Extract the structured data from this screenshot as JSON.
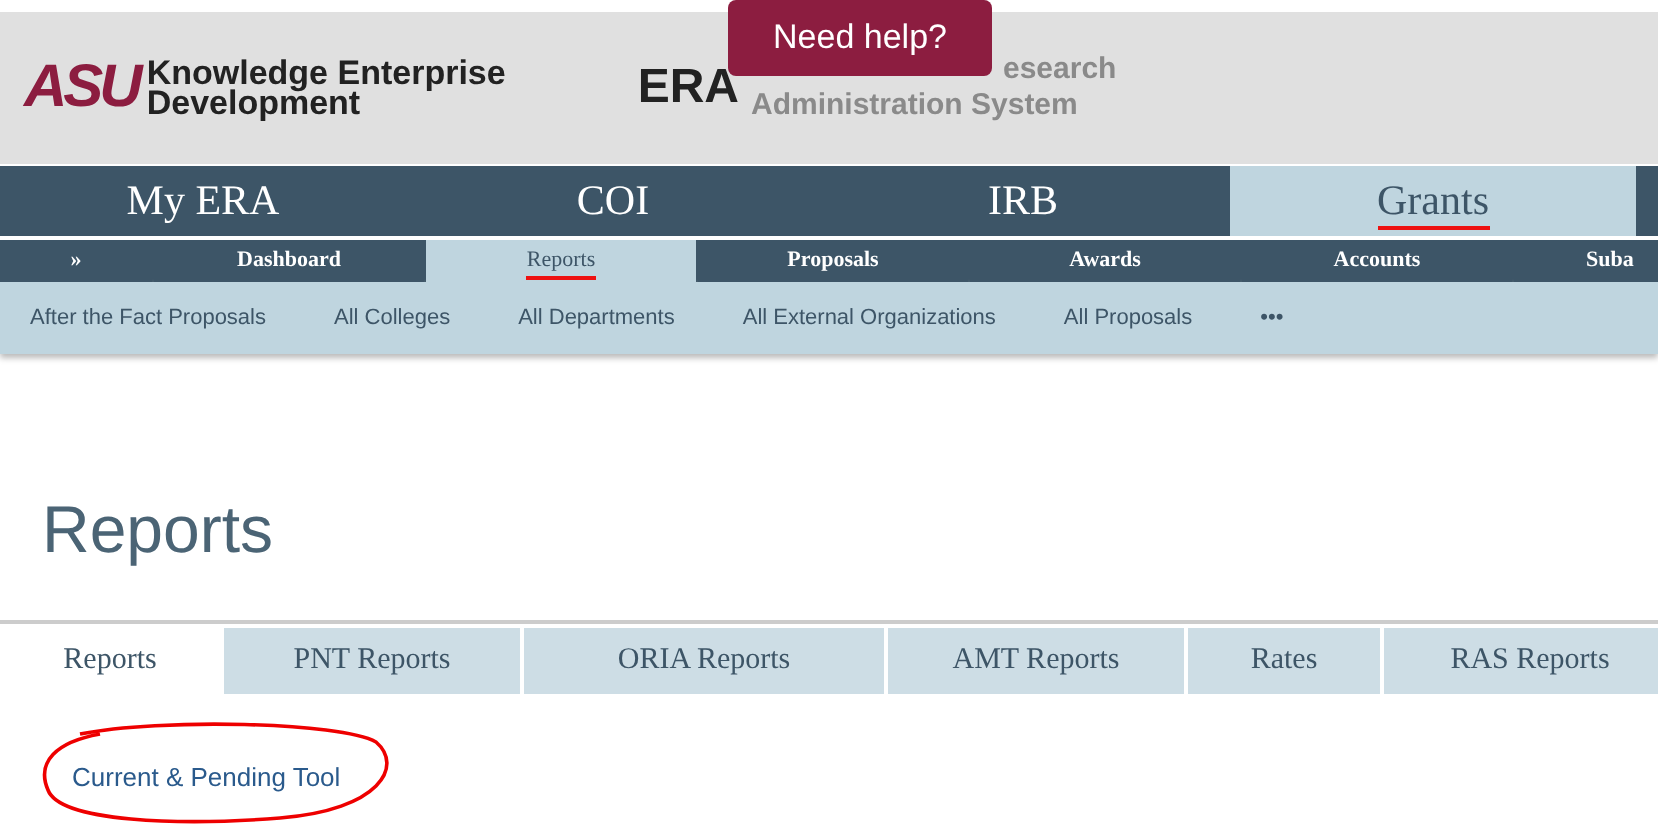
{
  "header": {
    "logo_mark": "ASU",
    "logo_text": [
      "Knowledge Enterprise",
      "Development"
    ],
    "era_mark": "ERA",
    "era_text": [
      "esearch",
      "Administration System"
    ],
    "help_button": "Need help?"
  },
  "main_nav": [
    {
      "label": "My ERA",
      "selected": false
    },
    {
      "label": "COI",
      "selected": false
    },
    {
      "label": "IRB",
      "selected": false
    },
    {
      "label": "Grants",
      "selected": true
    }
  ],
  "sub_nav": [
    {
      "label": "»",
      "selected": false
    },
    {
      "label": "Dashboard",
      "selected": false
    },
    {
      "label": "Reports",
      "selected": true
    },
    {
      "label": "Proposals",
      "selected": false
    },
    {
      "label": "Awards",
      "selected": false
    },
    {
      "label": "Accounts",
      "selected": false
    },
    {
      "label": "Suba",
      "selected": false
    }
  ],
  "report_links": [
    "After the Fact Proposals",
    "All Colleges",
    "All Departments",
    "All External Organizations",
    "All Proposals",
    "•••"
  ],
  "page_title": "Reports",
  "tabs": [
    {
      "label": "Reports",
      "selected": true
    },
    {
      "label": "PNT Reports",
      "selected": false
    },
    {
      "label": "ORIA Reports",
      "selected": false
    },
    {
      "label": "AMT Reports",
      "selected": false
    },
    {
      "label": "Rates",
      "selected": false
    },
    {
      "label": "RAS Reports",
      "selected": false
    }
  ],
  "links": [
    {
      "label": "Current & Pending Tool",
      "circled": true
    }
  ]
}
